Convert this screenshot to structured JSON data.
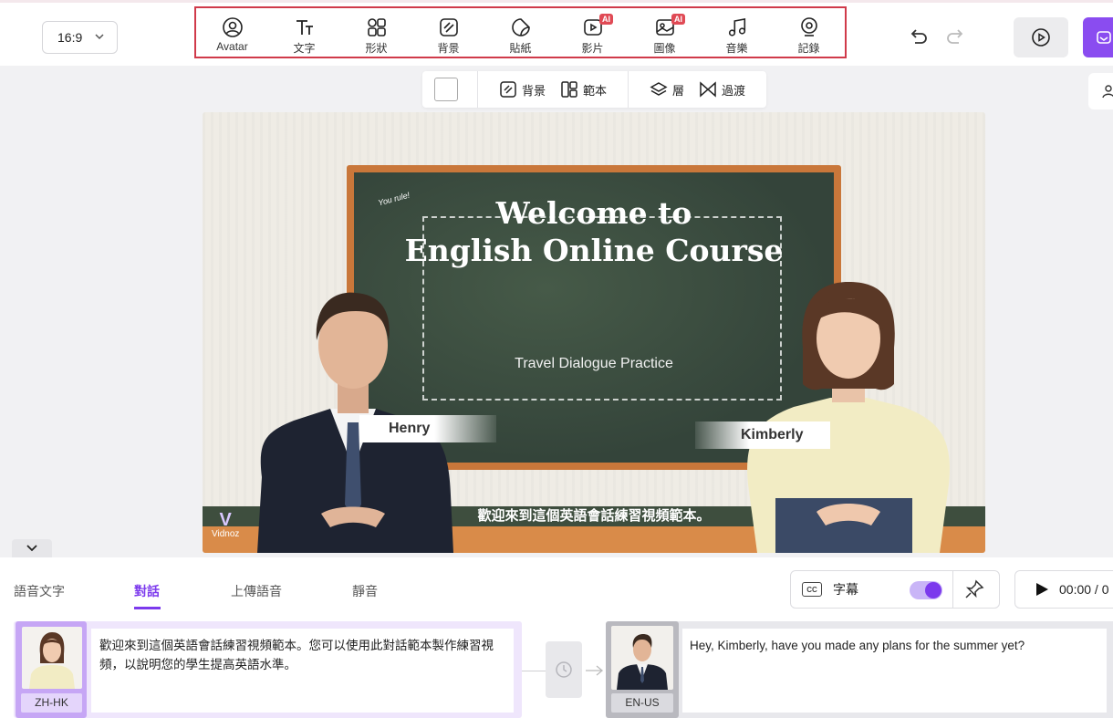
{
  "topbar": {
    "aspect_ratio": "16:9",
    "tools": [
      {
        "label": "Avatar",
        "icon": "avatar-icon",
        "ai": false
      },
      {
        "label": "文字",
        "icon": "text-icon",
        "ai": false
      },
      {
        "label": "形狀",
        "icon": "shapes-icon",
        "ai": false
      },
      {
        "label": "背景",
        "icon": "background-icon",
        "ai": false
      },
      {
        "label": "貼紙",
        "icon": "sticker-icon",
        "ai": false
      },
      {
        "label": "影片",
        "icon": "video-icon",
        "ai": true
      },
      {
        "label": "圖像",
        "icon": "image-icon",
        "ai": true
      },
      {
        "label": "音樂",
        "icon": "music-icon",
        "ai": false
      },
      {
        "label": "記錄",
        "icon": "record-icon",
        "ai": false
      }
    ],
    "ai_badge": "AI",
    "accent_color": "#8a4cf0",
    "highlight_color": "#d03a4a"
  },
  "subbar": {
    "background_label": "背景",
    "template_label": "範本",
    "layer_label": "層",
    "transition_label": "過渡"
  },
  "canvas": {
    "title_line1": "Welcome to",
    "title_line2": "English Online Course",
    "subtitle": "Travel Dialogue Practice",
    "speaker1": "Henry",
    "speaker2": "Kimberly",
    "caption": "歡迎來到這個英語會話練習視頻範本。",
    "logo_text": "Vidnoz",
    "doodle": "You rule!"
  },
  "bottom": {
    "tabs": [
      "語音文字",
      "對話",
      "上傳語音",
      "靜音"
    ],
    "active_tab": "對話",
    "cc_label": "字幕",
    "cc_icon_text": "CC",
    "time": "00:00 / 0",
    "dialog": [
      {
        "lang": "ZH-HK",
        "text": "歡迎來到這個英語會話練習視頻範本。您可以使用此對話範本製作練習視頻，以說明您的學生提高英語水準。"
      },
      {
        "lang": "EN-US",
        "text": "Hey, Kimberly, have you made any plans for the summer yet?"
      }
    ]
  }
}
